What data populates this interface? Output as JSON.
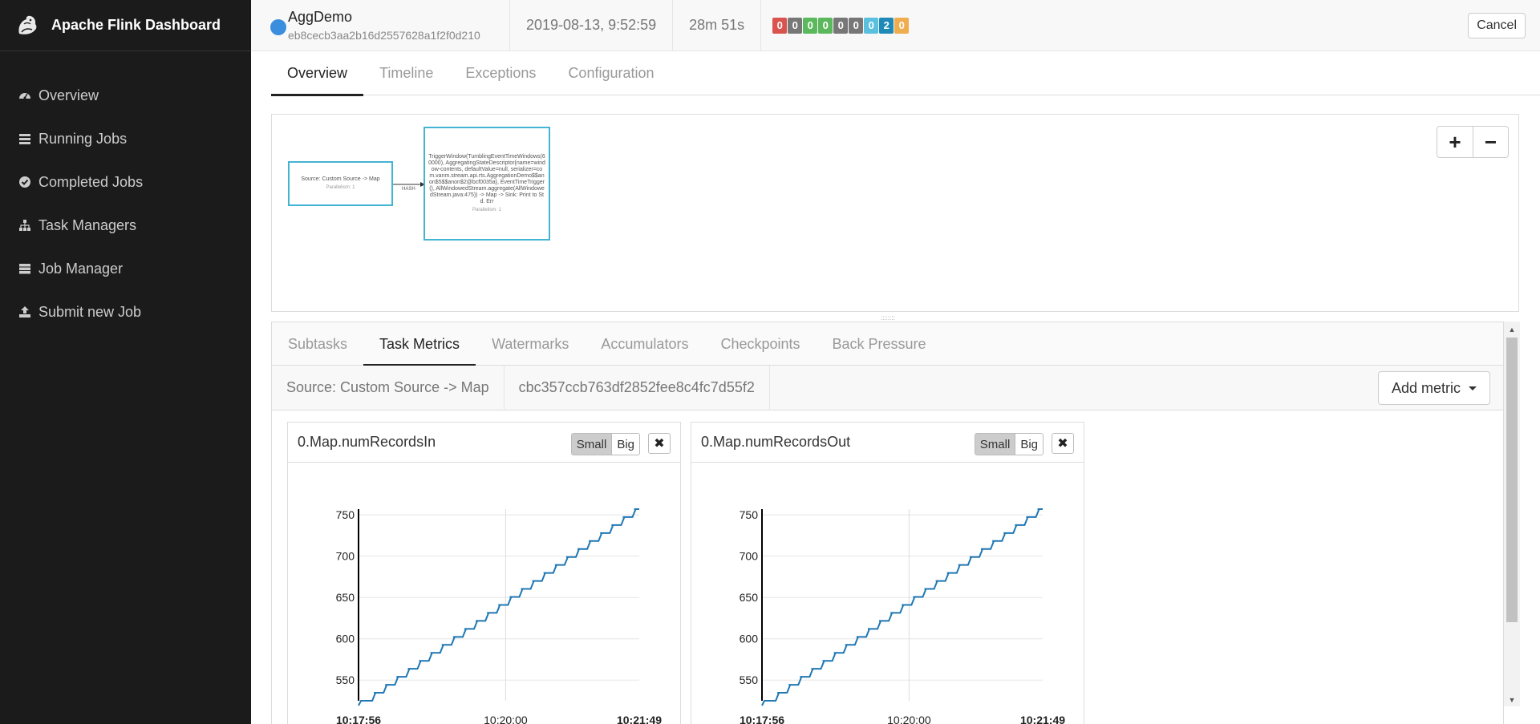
{
  "app": {
    "title": "Apache Flink Dashboard"
  },
  "sidebar": {
    "items": [
      {
        "label": "Overview",
        "icon": "dashboard-icon"
      },
      {
        "label": "Running Jobs",
        "icon": "list-icon"
      },
      {
        "label": "Completed Jobs",
        "icon": "check-circle-icon"
      },
      {
        "label": "Task Managers",
        "icon": "sitemap-icon"
      },
      {
        "label": "Job Manager",
        "icon": "server-icon"
      },
      {
        "label": "Submit new Job",
        "icon": "upload-icon"
      }
    ]
  },
  "job": {
    "name": "AggDemo",
    "id": "eb8cecb3aa2b16d2557628a1f2f0d210",
    "start_time": "2019-08-13, 9:52:59",
    "duration": "28m 51s",
    "status_color": "#3b8ede",
    "task_counts": [
      {
        "value": "0",
        "color": "#d9534f"
      },
      {
        "value": "0",
        "color": "#777777"
      },
      {
        "value": "0",
        "color": "#5cb85c"
      },
      {
        "value": "0",
        "color": "#5cb85c"
      },
      {
        "value": "0",
        "color": "#777777"
      },
      {
        "value": "0",
        "color": "#777777"
      },
      {
        "value": "0",
        "color": "#5bc0de"
      },
      {
        "value": "2",
        "color": "#1f8ab8"
      },
      {
        "value": "0",
        "color": "#f0ad4e"
      }
    ],
    "cancel_label": "Cancel"
  },
  "tabs": [
    {
      "label": "Overview",
      "active": true
    },
    {
      "label": "Timeline",
      "active": false
    },
    {
      "label": "Exceptions",
      "active": false
    },
    {
      "label": "Configuration",
      "active": false
    }
  ],
  "plan": {
    "source_node": {
      "text": "Source: Custom Source -> Map",
      "parallelism": "Parallelism: 1"
    },
    "edge_label": "HASH",
    "window_node": {
      "text": "TriggerWindow(TumblingEventTimeWindows(60000), AggregatingStateDescriptor{name=window-contents, defaultValue=null, serializer=com.vanm.stream.api.rts.AggregationDemo$$anon$5$$anon$2@bcf0035a}, EventTimeTrigger(), AllWindowedStream.aggregate(AllWindowedStream.java:475)) -> Map -> Sink: Print to Std. Err",
      "parallelism": "Parallelism: 1"
    },
    "zoom_in": "+",
    "zoom_out": "−",
    "grip": "::::::::"
  },
  "subtabs": [
    {
      "label": "Subtasks",
      "active": false
    },
    {
      "label": "Task Metrics",
      "active": true
    },
    {
      "label": "Watermarks",
      "active": false
    },
    {
      "label": "Accumulators",
      "active": false
    },
    {
      "label": "Checkpoints",
      "active": false
    },
    {
      "label": "Back Pressure",
      "active": false
    }
  ],
  "vertex": {
    "name": "Source: Custom Source -> Map",
    "id": "cbc357ccb763df2852fee8c4fc7d55f2",
    "add_metric_label": "Add metric"
  },
  "metrics": [
    {
      "title": "0.Map.numRecordsIn",
      "small": "Small",
      "big": "Big",
      "close": "✖"
    },
    {
      "title": "0.Map.numRecordsOut",
      "small": "Small",
      "big": "Big",
      "close": "✖"
    }
  ],
  "chart_data": [
    {
      "type": "line",
      "title": "0.Map.numRecordsIn",
      "xlabel": "",
      "ylabel": "",
      "x_ticks": [
        "10:17:56",
        "10:20:00",
        "10:21:49"
      ],
      "y_ticks": [
        550,
        600,
        650,
        700,
        750
      ],
      "ylim": [
        525,
        755
      ],
      "grid": true,
      "series": [
        {
          "color": "#1f77b4",
          "x_minutes": [
            0,
            3.88
          ],
          "y": [
            525,
            757
          ]
        }
      ]
    },
    {
      "type": "line",
      "title": "0.Map.numRecordsOut",
      "xlabel": "",
      "ylabel": "",
      "x_ticks": [
        "10:17:56",
        "10:20:00",
        "10:21:49"
      ],
      "y_ticks": [
        550,
        600,
        650,
        700,
        750
      ],
      "ylim": [
        525,
        755
      ],
      "grid": true,
      "series": [
        {
          "color": "#1f77b4",
          "x_minutes": [
            0,
            3.88
          ],
          "y": [
            525,
            757
          ]
        }
      ]
    }
  ]
}
